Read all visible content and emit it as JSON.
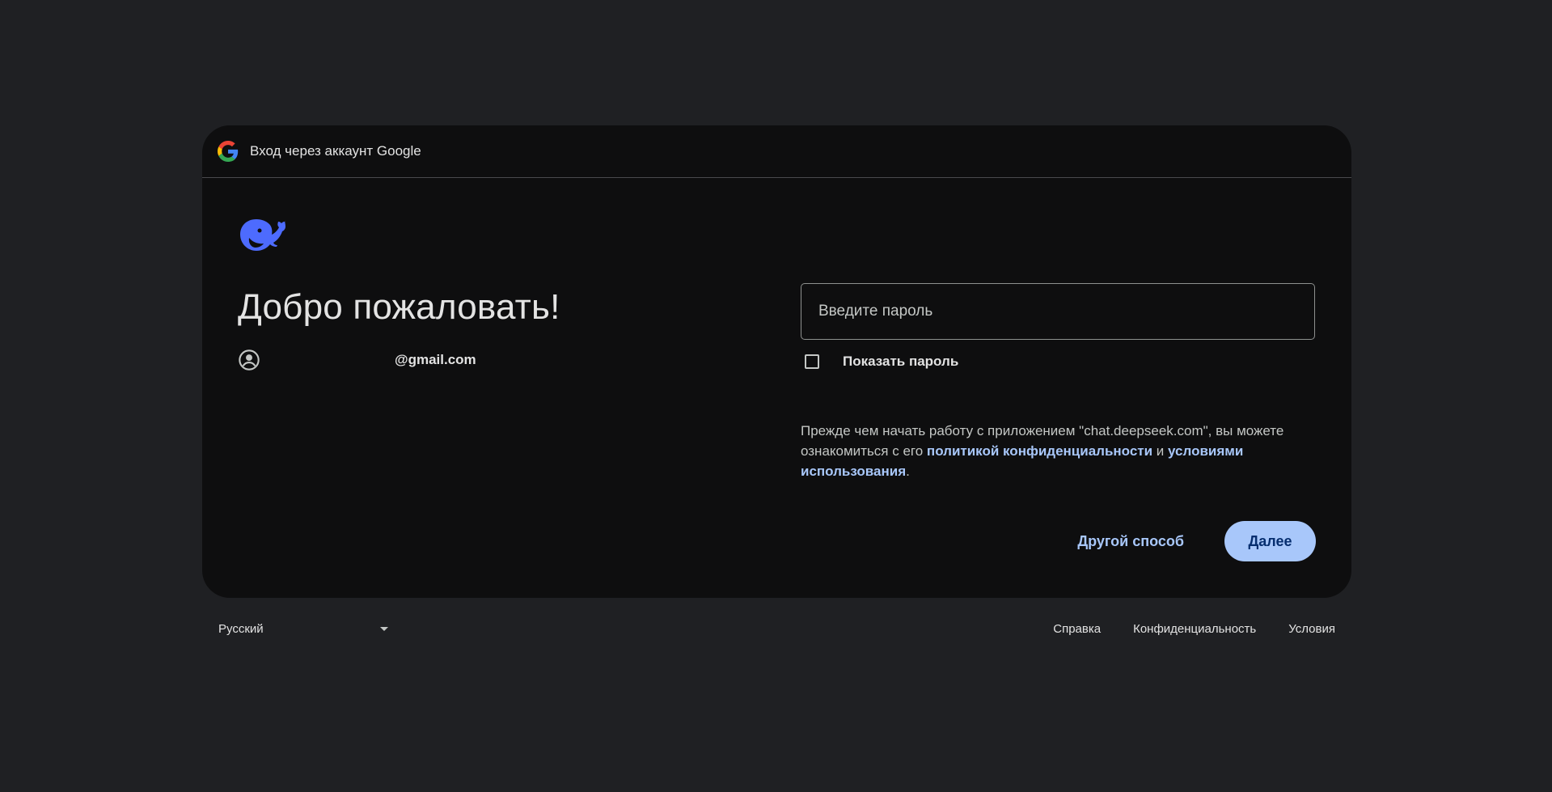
{
  "header": {
    "title": "Вход через аккаунт Google",
    "icon": "google-g-icon"
  },
  "left": {
    "logo": "deepseek-whale-icon",
    "welcome": "Добро пожаловать!",
    "account_icon": "account-circle-icon",
    "email": "@gmail.com"
  },
  "form": {
    "password_placeholder": "Введите пароль",
    "password_value": "",
    "show_password_label": "Показать пароль",
    "show_password_checked": false
  },
  "consent": {
    "prefix": "Прежде чем начать работу с приложением \"chat.deepseek.com\", вы можете ознакомиться с его ",
    "privacy_link": "политикой конфиденциальности",
    "conjunction": " и ",
    "terms_link": "условиями использования",
    "suffix": "."
  },
  "actions": {
    "other_way": "Другой способ",
    "next": "Далее"
  },
  "footer": {
    "language": "Русский",
    "links": [
      "Справка",
      "Конфиденциальность",
      "Условия"
    ]
  },
  "colors": {
    "background": "#1f2023",
    "card": "#0e0e0f",
    "accent": "#a8c7fa",
    "logo": "#4d6bfe"
  }
}
